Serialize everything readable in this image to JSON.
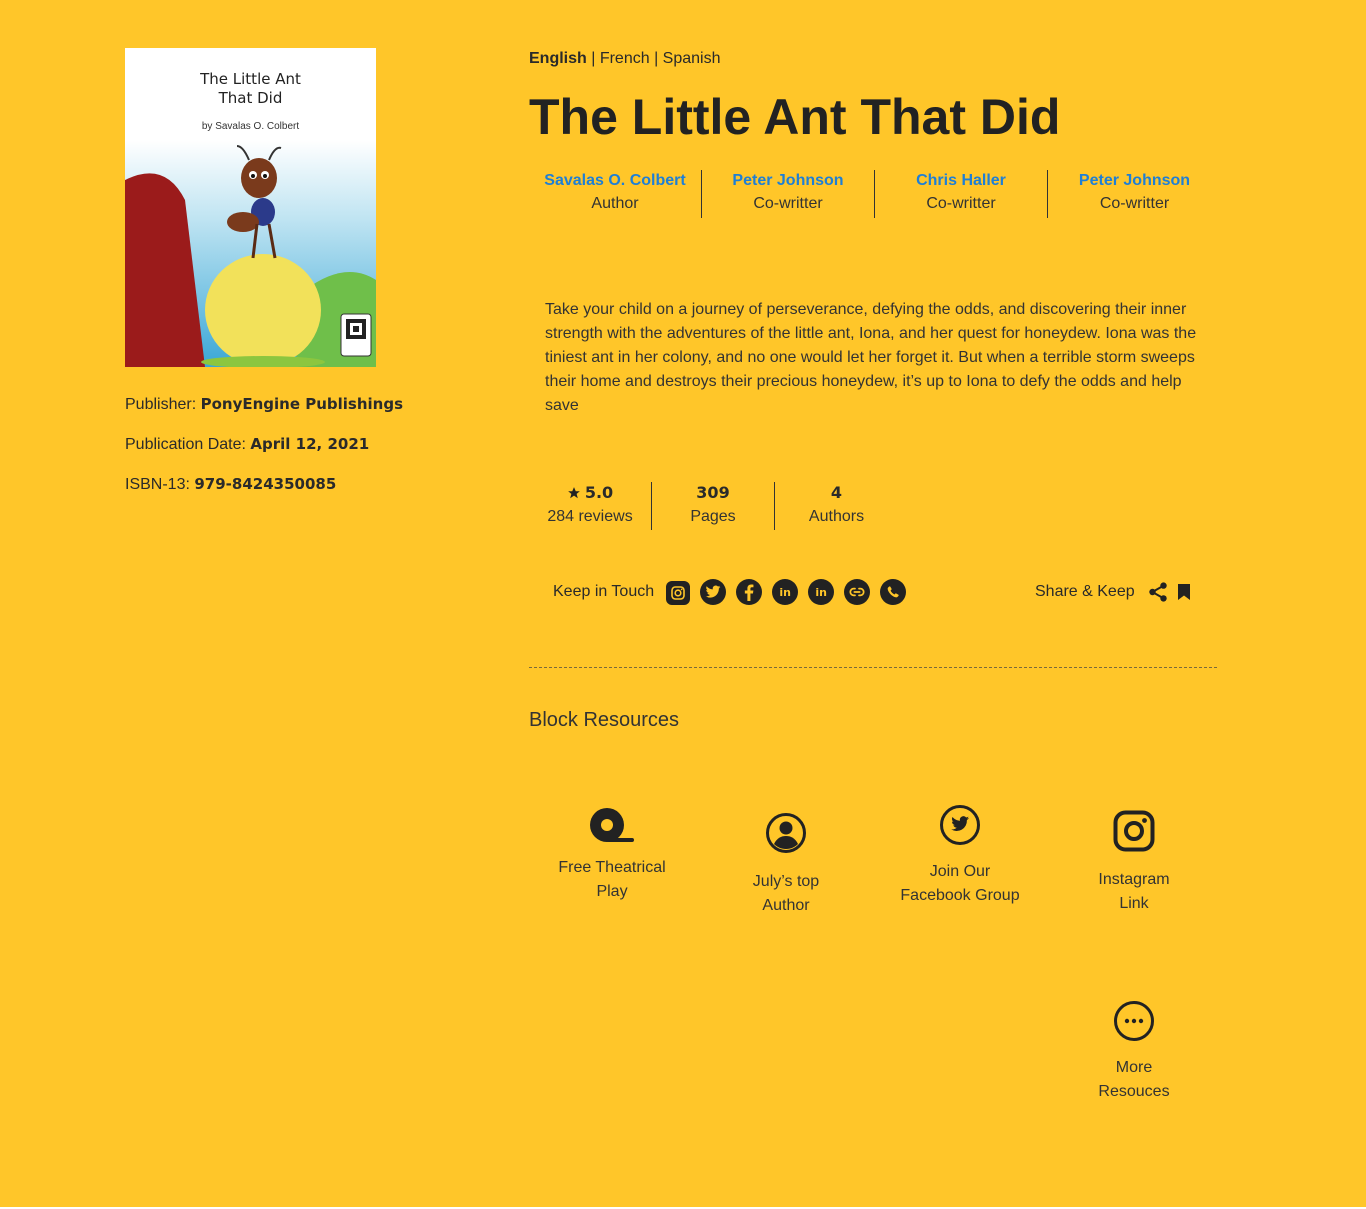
{
  "book": {
    "cover_title": "The Little Ant\nThat Did",
    "cover_author": "by Savalas O. Colbert",
    "publisher_label": "Publisher:",
    "publisher": "PonyEngine Publishings",
    "date_label": "Publication Date:",
    "date": "April 12, 2021",
    "isbn_label": "ISBN-13:",
    "isbn": "979-8424350085"
  },
  "languages": {
    "active": "English",
    "others": " | French | Spanish"
  },
  "title": "The Little Ant That Did",
  "people": [
    {
      "name": "Savalas O. Colbert",
      "role": "Author"
    },
    {
      "name": "Peter Johnson",
      "role": "Co-writter"
    },
    {
      "name": "Chris Haller",
      "role": "Co-writter"
    },
    {
      "name": "Peter Johnson",
      "role": "Co-writter"
    }
  ],
  "description": "Take your child on a journey of perseverance, defying the odds, and discovering their inner strength with the adventures of the little ant, Iona, and her quest for honeydew. Iona was the tiniest ant in her colony, and no one would let her forget it. But when a terrible storm sweeps their home and destroys their precious honeydew, it’s up to Iona to defy the odds and help save",
  "stats": {
    "rating": "5.0",
    "reviews": "284 reviews",
    "pages_value": "309",
    "pages_label": "Pages",
    "authors_value": "4",
    "authors_label": "Authors"
  },
  "touch": {
    "label": "Keep in Touch",
    "icons": [
      "instagram-icon",
      "twitter-icon",
      "facebook-icon",
      "linkedin-icon",
      "linkedin-icon",
      "link-icon",
      "whatsapp-icon"
    ]
  },
  "share": {
    "label": "Share & Keep",
    "icons": [
      "share-icon",
      "bookmark-icon"
    ]
  },
  "resources": {
    "title": "Block Resources",
    "items": [
      {
        "label": "Free Theatrical\nPlay",
        "icon": "tape-icon"
      },
      {
        "label": "July’s top\nAuthor",
        "icon": "user-circle-icon"
      },
      {
        "label": "Join Our\nFacebook Group",
        "icon": "twitter-circle-icon"
      },
      {
        "label": "Instagram\nLink",
        "icon": "instagram-icon"
      },
      {
        "label": "More\nResouces",
        "icon": "more-circle-icon"
      }
    ]
  },
  "colors": {
    "background": "#FFC629",
    "link": "#1e7fd6",
    "text": "#2a2a2a"
  }
}
